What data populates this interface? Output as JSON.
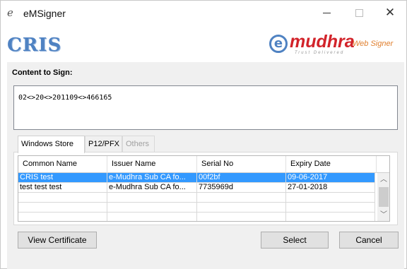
{
  "window": {
    "title": "eMSigner",
    "app_icon_glyph": "e"
  },
  "brand": {
    "left_logo": "CRIS",
    "right_logo_mark": "e",
    "right_logo_name": "mudhra",
    "right_logo_tagline": "Trust Delivered",
    "right_logo_product": "Web Signer",
    "colors": {
      "blue": "#4f82c2",
      "red": "#d2232a",
      "orange": "#e08030"
    }
  },
  "content": {
    "label": "Content to Sign:",
    "value": "02<>20<>201109<>466165"
  },
  "tabs": [
    {
      "label": "Windows Store",
      "active": true,
      "disabled": false
    },
    {
      "label": "P12/PFX",
      "active": false,
      "disabled": false
    },
    {
      "label": "Others",
      "active": false,
      "disabled": true
    }
  ],
  "grid": {
    "columns": [
      "Common Name",
      "Issuer Name",
      "Serial No",
      "Expiry Date"
    ],
    "rows": [
      {
        "common_name": "CRIS test",
        "issuer_name": "e-Mudhra Sub CA fo...",
        "serial_no": "00f2bf",
        "expiry_date": "09-06-2017",
        "selected": true
      },
      {
        "common_name": "test test test",
        "issuer_name": "e-Mudhra Sub CA fo...",
        "serial_no": "7735969d",
        "expiry_date": "27-01-2018",
        "selected": false
      },
      {
        "common_name": "",
        "issuer_name": "",
        "serial_no": "",
        "expiry_date": "",
        "selected": false
      },
      {
        "common_name": "",
        "issuer_name": "",
        "serial_no": "",
        "expiry_date": "",
        "selected": false
      },
      {
        "common_name": "",
        "issuer_name": "",
        "serial_no": "",
        "expiry_date": "",
        "selected": false
      }
    ],
    "selection_color": "#3399ff"
  },
  "buttons": {
    "view_certificate": "View Certificate",
    "select": "Select",
    "cancel": "Cancel"
  }
}
